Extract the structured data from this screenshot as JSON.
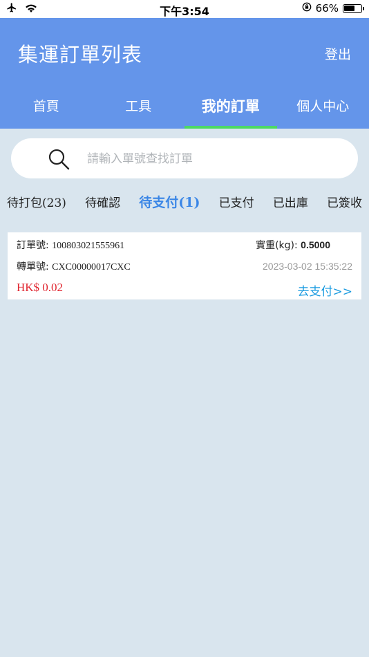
{
  "status_bar": {
    "time": "下午3:54",
    "battery_text": "66%",
    "battery_level": 0.66
  },
  "header": {
    "title": "集運訂單列表",
    "logout_label": "登出"
  },
  "tabs": [
    {
      "label": "首頁",
      "active": false
    },
    {
      "label": "工具",
      "active": false
    },
    {
      "label": "我的訂單",
      "active": true
    },
    {
      "label": "個人中心",
      "active": false
    }
  ],
  "search": {
    "placeholder": "請輸入單號查找訂單",
    "value": ""
  },
  "filters": [
    {
      "label": "待打包",
      "count": "(23)",
      "active": false
    },
    {
      "label": "待確認",
      "count": "",
      "active": false
    },
    {
      "label": "待支付",
      "count": "(1)",
      "active": true
    },
    {
      "label": "已支付",
      "count": "",
      "active": false
    },
    {
      "label": "已出庫",
      "count": "",
      "active": false
    },
    {
      "label": "已簽收",
      "count": "",
      "active": false
    }
  ],
  "orders": [
    {
      "order_no_label": "訂單號:",
      "order_no": "100803021555961",
      "weight_label": "實重(kg):",
      "weight": "0.5000",
      "transfer_no_label": "轉單號:",
      "transfer_no": "CXC00000017CXC",
      "datetime": "2023-03-02 15:35:22",
      "price": "HK$ 0.02",
      "pay_label": "去支付>>"
    }
  ],
  "colors": {
    "header_bg": "#6495ea",
    "tab_indicator": "#4cd964",
    "active_filter": "#3a86e6",
    "price": "#e0242e",
    "pay_link": "#1a9be0",
    "page_bg": "#d9e5ee"
  }
}
